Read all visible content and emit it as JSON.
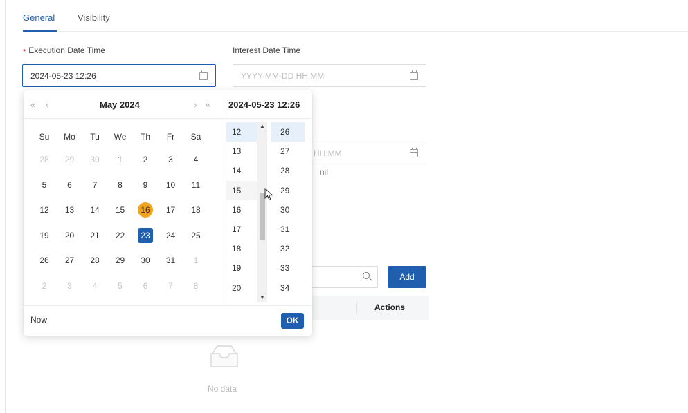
{
  "tabs": [
    {
      "label": "General",
      "active": true
    },
    {
      "label": "Visibility",
      "active": false
    }
  ],
  "form": {
    "execution_label": "Execution Date Time",
    "execution_value": "2024-05-23 12:26",
    "interest_label": "Interest Date Time",
    "interest_placeholder": "YYYY-MM-DD HH:MM",
    "hidden_field_placeholder": "HH:MM",
    "hidden_hint": "nil"
  },
  "table": {
    "add_label": "Add",
    "actions_header": "Actions",
    "empty_text": "No data"
  },
  "picker": {
    "nav_prev_year": "«",
    "nav_prev_month": "‹",
    "nav_next_month": "›",
    "nav_next_year": "»",
    "month_label": "May",
    "year_label": "2024",
    "selected_datetime": "2024-05-23 12:26",
    "weekdays": [
      "Su",
      "Mo",
      "Tu",
      "We",
      "Th",
      "Fr",
      "Sa"
    ],
    "weeks": [
      [
        {
          "d": "28",
          "m": true
        },
        {
          "d": "29",
          "m": true
        },
        {
          "d": "30",
          "m": true
        },
        {
          "d": "1"
        },
        {
          "d": "2"
        },
        {
          "d": "3"
        },
        {
          "d": "4"
        }
      ],
      [
        {
          "d": "5"
        },
        {
          "d": "6"
        },
        {
          "d": "7"
        },
        {
          "d": "8"
        },
        {
          "d": "9"
        },
        {
          "d": "10"
        },
        {
          "d": "11"
        }
      ],
      [
        {
          "d": "12"
        },
        {
          "d": "13"
        },
        {
          "d": "14"
        },
        {
          "d": "15"
        },
        {
          "d": "16",
          "today": true
        },
        {
          "d": "17"
        },
        {
          "d": "18"
        }
      ],
      [
        {
          "d": "19"
        },
        {
          "d": "20"
        },
        {
          "d": "21"
        },
        {
          "d": "22"
        },
        {
          "d": "23",
          "selected": true
        },
        {
          "d": "24"
        },
        {
          "d": "25"
        }
      ],
      [
        {
          "d": "26"
        },
        {
          "d": "27"
        },
        {
          "d": "28"
        },
        {
          "d": "29"
        },
        {
          "d": "30"
        },
        {
          "d": "31"
        },
        {
          "d": "1",
          "m": true
        }
      ],
      [
        {
          "d": "2",
          "m": true
        },
        {
          "d": "3",
          "m": true
        },
        {
          "d": "4",
          "m": true
        },
        {
          "d": "5",
          "m": true
        },
        {
          "d": "6",
          "m": true
        },
        {
          "d": "7",
          "m": true
        },
        {
          "d": "8",
          "m": true
        }
      ]
    ],
    "hours": [
      "12",
      "13",
      "14",
      "15",
      "16",
      "17",
      "18",
      "19",
      "20"
    ],
    "selected_hour": "12",
    "minutes": [
      "26",
      "27",
      "28",
      "29",
      "30",
      "31",
      "32",
      "33",
      "34"
    ],
    "selected_minute": "26",
    "scroll_up_glyph": "▲",
    "scroll_down_glyph": "▼",
    "now_label": "Now",
    "ok_label": "OK"
  },
  "colors": {
    "accent": "#1f5fae",
    "today": "#f2a41c",
    "required": "#e0463b"
  }
}
